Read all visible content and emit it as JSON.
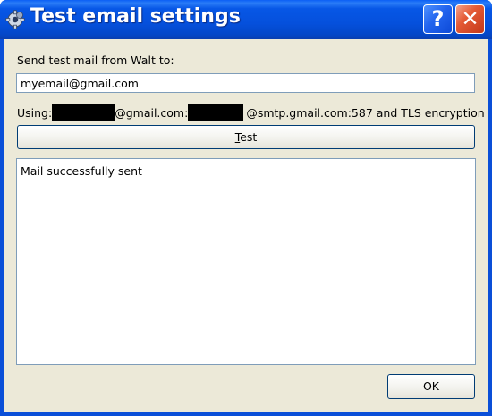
{
  "window": {
    "title": "Test email settings",
    "help_button_label": "?",
    "close_button_label": "✕"
  },
  "form": {
    "send_label": "Send test mail from Walt to:",
    "email_value": "myemail@gmail.com",
    "using_prefix": "Using:",
    "using_mid": "@gmail.com:",
    "using_suffix": "@smtp.gmail.com:587 and TLS encryption",
    "test_button_mnemonic": "T",
    "test_button_rest": "est"
  },
  "log": {
    "text": "Mail successfully sent"
  },
  "footer": {
    "ok_label": "OK"
  },
  "colors": {
    "titlebar": "#0550dc",
    "client_background": "#ece9d8",
    "close_button": "#e45a35",
    "help_button": "#2264ee",
    "input_border": "#7f9db9",
    "button_border": "#003c74"
  },
  "icons": {
    "app": "gear-icon",
    "help": "help-icon",
    "close": "close-icon"
  }
}
